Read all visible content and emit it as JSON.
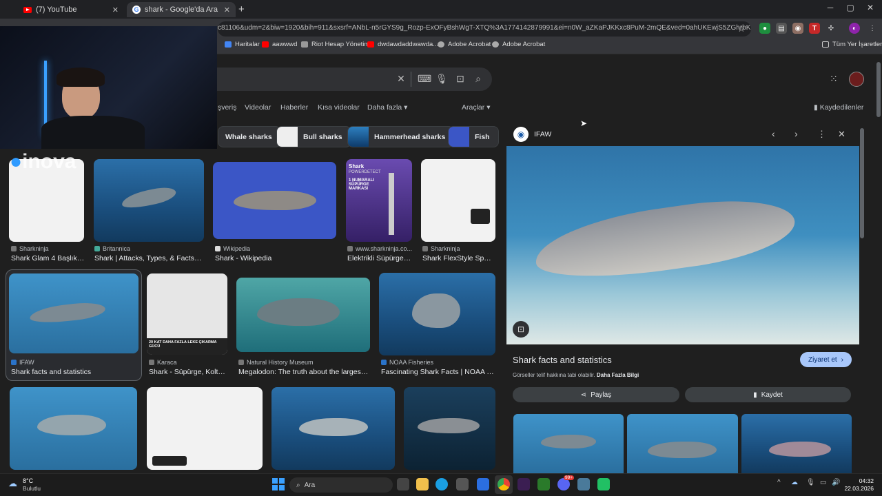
{
  "tabs": [
    {
      "label": "(7) YouTube",
      "icon": "youtube-icon",
      "active": false
    },
    {
      "label": "shark - Google'da Ara",
      "icon": "google-icon",
      "active": true
    }
  ],
  "new_tab": "+",
  "window_controls": {
    "minimize": "─",
    "maximize": "▢",
    "close": "✕"
  },
  "address": "c81106&udm=2&biw=1920&bih=911&sxsrf=ANbL-n5rGYS9g_Rozp-ExOFyBshWgT-XTQ%3A1774142879991&ei=n0W_aZKaPJKKxc8PuM-2mQE&ved=0ahUKEwjS5ZGhrbKTAxUSRf...",
  "bookmarks": [
    "Haritalar",
    "aawwwd",
    "Riot Hesap Yönetimi",
    "dwdawdaddwawda...",
    "Adobe Acrobat",
    "Adobe Acrobat"
  ],
  "all_bookmarks": "Tüm Yer İşaretleri",
  "search": {
    "clear": "✕"
  },
  "nav_tabs": [
    "şveriş",
    "Videolar",
    "Haberler",
    "Kısa videolar",
    "Daha fazla",
    "Araçlar"
  ],
  "saved": "Kaydedilenler",
  "chips": [
    "Whale sharks",
    "Bull sharks",
    "Hammerhead sharks",
    "Fish"
  ],
  "watermark": "inova",
  "results": [
    {
      "source": "Sharkninja",
      "title": "Shark Glam 4 Başlıklı..."
    },
    {
      "source": "Britannica",
      "title": "Shark | Attacks, Types, & Facts | ..."
    },
    {
      "source": "Wikipedia",
      "title": "Shark - Wikipedia"
    },
    {
      "source": "www.sharkninja.co...",
      "title": "Elektrikli Süpürge, ..."
    },
    {
      "source": "Sharkninja",
      "title": "Shark FlexStyle Spar..."
    },
    {
      "source": "IFAW",
      "title": "Shark facts and statistics"
    },
    {
      "source": "Karaca",
      "title": "Shark - Süpürge, Koltu..."
    },
    {
      "source": "Natural History Museum",
      "title": "Megalodon: The truth about the largest sh..."
    },
    {
      "source": "NOAA Fisheries",
      "title": "Fascinating Shark Facts | NOAA Fis..."
    }
  ],
  "ad_text": {
    "brand": "Shark",
    "tag": "POWERDETECT",
    "badge": "1 NUMARALI SÜPÜRGE MARKASI",
    "promo": "20 KAT DAHA FAZLA LEKE ÇIKARMA GÜCÜ"
  },
  "preview": {
    "source": "IFAW",
    "title": "Shark facts and statistics",
    "visit": "Ziyaret et",
    "copyright": "Görseller telif hakkına tabi olabilir.",
    "more_info": "Daha Fazla Bilgi",
    "share": "Paylaş",
    "save": "Kaydet"
  },
  "taskbar": {
    "weather_temp": "8°C",
    "weather_desc": "Bulutlu",
    "search": "Ara",
    "time": "04:32",
    "date": "22.03.2026",
    "badge": "99+"
  },
  "colors": {
    "accent": "#8ab4f8",
    "visit_btn": "#a8c7fa",
    "page_bg": "#1f1f1f"
  }
}
